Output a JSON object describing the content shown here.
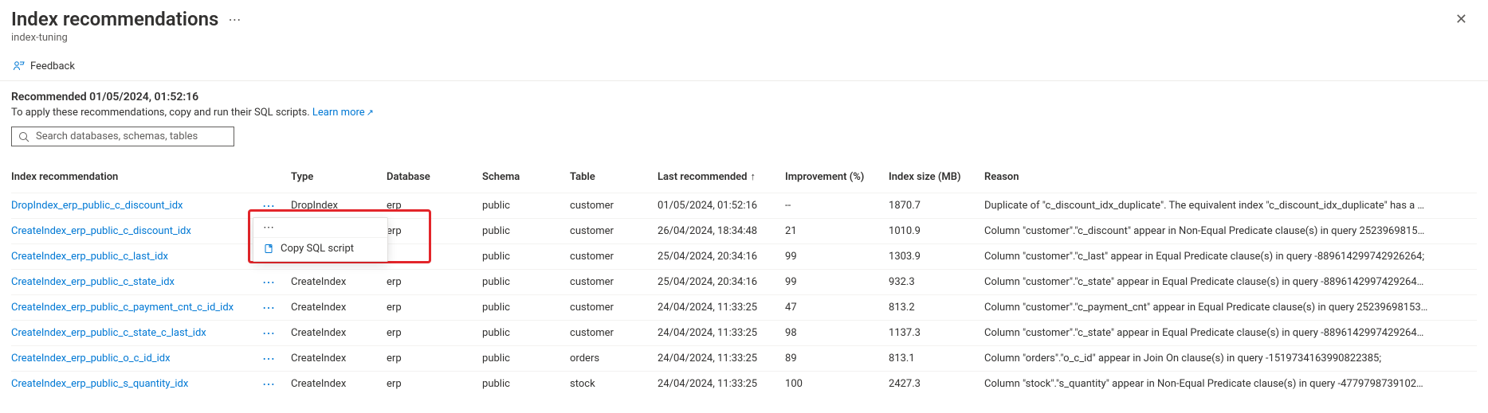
{
  "header": {
    "title": "Index recommendations",
    "subtitle": "index-tuning"
  },
  "toolbar": {
    "feedback_label": "Feedback"
  },
  "summary": {
    "recommended_prefix": "Recommended ",
    "recommended_timestamp": "01/05/2024, 01:52:16",
    "apply_text": "To apply these recommendations, copy and run their SQL scripts.",
    "learn_more_label": "Learn more"
  },
  "search": {
    "placeholder": "Search databases, schemas, tables"
  },
  "table": {
    "columns": {
      "name": "Index recommendation",
      "type": "Type",
      "database": "Database",
      "schema": "Schema",
      "table": "Table",
      "last": "Last recommended",
      "sort_arrow": "↑",
      "improvement": "Improvement (%)",
      "size": "Index size (MB)",
      "reason": "Reason"
    },
    "rows": [
      {
        "name": "DropIndex_erp_public_c_discount_idx",
        "type": "DropIndex",
        "database": "erp",
        "schema": "public",
        "table": "customer",
        "last": "01/05/2024, 01:52:16",
        "improvement": "--",
        "size": "1870.7",
        "reason": "Duplicate of \"c_discount_idx_duplicate\". The equivalent index \"c_discount_idx_duplicate\" has a …",
        "menu_open": false
      },
      {
        "name": "CreateIndex_erp_public_c_discount_idx",
        "type": "CreateIndex",
        "database": "erp",
        "schema": "public",
        "table": "customer",
        "last": "26/04/2024, 18:34:48",
        "improvement": "21",
        "size": "1010.9",
        "reason": "Column \"customer\".\"c_discount\" appear in Non-Equal Predicate clause(s) in query 2523969815…",
        "menu_open": true
      },
      {
        "name": "CreateIndex_erp_public_c_last_idx",
        "type": "",
        "database": "",
        "schema": "public",
        "table": "customer",
        "last": "25/04/2024, 20:34:16",
        "improvement": "99",
        "size": "1303.9",
        "reason": "Column \"customer\".\"c_last\" appear in Equal Predicate clause(s) in query -889614299742926264;",
        "menu_open": false,
        "obscured": true
      },
      {
        "name": "CreateIndex_erp_public_c_state_idx",
        "type": "CreateIndex",
        "database": "erp",
        "schema": "public",
        "table": "customer",
        "last": "25/04/2024, 20:34:16",
        "improvement": "99",
        "size": "932.3",
        "reason": "Column \"customer\".\"c_state\" appear in Equal Predicate clause(s) in query -8896142997429264…",
        "menu_open": false
      },
      {
        "name": "CreateIndex_erp_public_c_payment_cnt_c_id_idx",
        "type": "CreateIndex",
        "database": "erp",
        "schema": "public",
        "table": "customer",
        "last": "24/04/2024, 11:33:25",
        "improvement": "47",
        "size": "813.2",
        "reason": "Column \"customer\".\"c_payment_cnt\" appear in Equal Predicate clause(s) in query 25239698153…",
        "menu_open": false
      },
      {
        "name": "CreateIndex_erp_public_c_state_c_last_idx",
        "type": "CreateIndex",
        "database": "erp",
        "schema": "public",
        "table": "customer",
        "last": "24/04/2024, 11:33:25",
        "improvement": "98",
        "size": "1137.3",
        "reason": "Column \"customer\".\"c_state\" appear in Equal Predicate clause(s) in query -8896142997429264…",
        "menu_open": false
      },
      {
        "name": "CreateIndex_erp_public_o_c_id_idx",
        "type": "CreateIndex",
        "database": "erp",
        "schema": "public",
        "table": "orders",
        "last": "24/04/2024, 11:33:25",
        "improvement": "89",
        "size": "813.1",
        "reason": "Column \"orders\".\"o_c_id\" appear in Join On clause(s) in query -1519734163990822385;",
        "menu_open": false
      },
      {
        "name": "CreateIndex_erp_public_s_quantity_idx",
        "type": "CreateIndex",
        "database": "erp",
        "schema": "public",
        "table": "stock",
        "last": "24/04/2024, 11:33:25",
        "improvement": "100",
        "size": "2427.3",
        "reason": "Column \"stock\".\"s_quantity\" appear in Non-Equal Predicate clause(s) in query -4779798739102…",
        "menu_open": false
      }
    ]
  },
  "context_menu": {
    "copy_label": "Copy SQL script"
  }
}
